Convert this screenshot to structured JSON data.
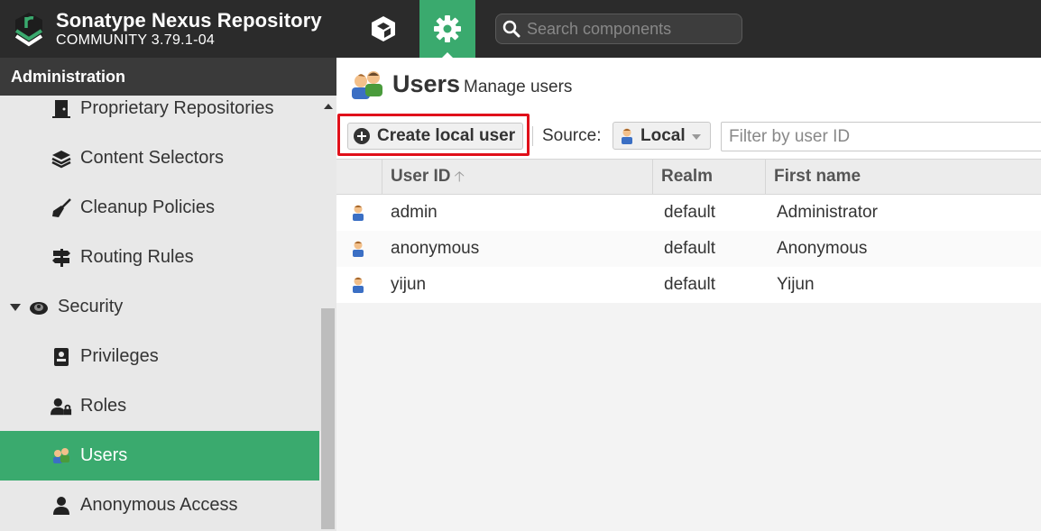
{
  "header": {
    "product_name": "Sonatype Nexus Repository",
    "edition": "COMMUNITY 3.79.1-04",
    "search_placeholder": "Search components"
  },
  "sidebar": {
    "title": "Administration",
    "items": [
      {
        "label": "Proprietary Repositories",
        "icon": "door-icon"
      },
      {
        "label": "Content Selectors",
        "icon": "layers-icon"
      },
      {
        "label": "Cleanup Policies",
        "icon": "broom-icon"
      },
      {
        "label": "Routing Rules",
        "icon": "signpost-icon"
      },
      {
        "label": "Security",
        "icon": "security-icon",
        "group": true,
        "expanded": true
      },
      {
        "label": "Privileges",
        "icon": "badge-icon"
      },
      {
        "label": "Roles",
        "icon": "user-lock-icon"
      },
      {
        "label": "Users",
        "icon": "users-icon",
        "selected": true
      },
      {
        "label": "Anonymous Access",
        "icon": "user-icon"
      }
    ]
  },
  "page": {
    "title": "Users",
    "subtitle": "Manage users"
  },
  "toolbar": {
    "create_label": "Create local user",
    "source_label": "Source:",
    "source_value": "Local",
    "filter_placeholder": "Filter by user ID"
  },
  "table": {
    "columns": [
      "User ID",
      "Realm",
      "First name"
    ],
    "rows": [
      {
        "user_id": "admin",
        "realm": "default",
        "first_name": "Administrator"
      },
      {
        "user_id": "anonymous",
        "realm": "default",
        "first_name": "Anonymous"
      },
      {
        "user_id": "yijun",
        "realm": "default",
        "first_name": "Yijun"
      }
    ]
  },
  "colors": {
    "accent_green": "#3aaa6e",
    "header_bg": "#2b2b2b",
    "highlight_red": "#e0101a"
  }
}
